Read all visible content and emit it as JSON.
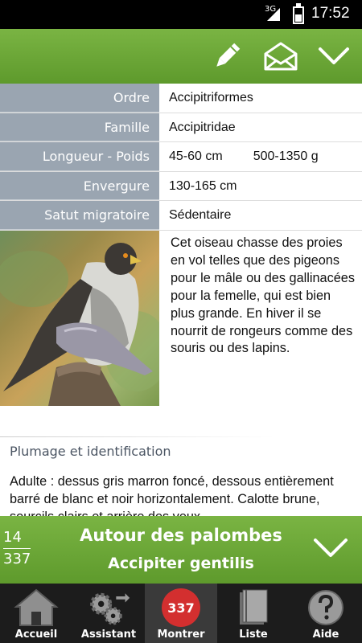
{
  "status_bar": {
    "network": "3G",
    "time": "17:52"
  },
  "toolbar": {
    "icons": [
      "pencil-icon",
      "envelope-icon",
      "chevron-down-icon"
    ]
  },
  "info_table": [
    {
      "label": "Ordre",
      "value": "Accipitriformes",
      "value2": ""
    },
    {
      "label": "Famille",
      "value": "Accipitridae",
      "value2": ""
    },
    {
      "label": "Longueur - Poids",
      "value": "45-60 cm",
      "value2": "500-1350 g"
    },
    {
      "label": "Envergure",
      "value": "130-165 cm",
      "value2": ""
    },
    {
      "label": "Satut migratoire",
      "value": "Sédentaire",
      "value2": ""
    }
  ],
  "description": "Cet oiseau chasse des proies en vol telles que des pigeons pour le mâle ou des gallinacées pour la femelle, qui est bien plus grande. En hiver il se nourrit de rongeurs comme des souris ou des lapins.",
  "plumage": {
    "title": "Plumage et identification",
    "text": "Adulte : dessus gris marron foncé, dessous entièrement barré de blanc et noir horizontalement. Calotte brune, sourcils clairs et arrière des yeux"
  },
  "species": {
    "index": "14",
    "total": "337",
    "common_name": "Autour des palombes",
    "latin_name": "Accipiter gentilis"
  },
  "bottom_nav": [
    {
      "label": "Accueil",
      "icon": "home-icon"
    },
    {
      "label": "Assistant",
      "icon": "gears-icon"
    },
    {
      "label": "Montrer",
      "icon": "count-badge",
      "badge": "337"
    },
    {
      "label": "Liste",
      "icon": "book-icon"
    },
    {
      "label": "Aide",
      "icon": "help-icon"
    }
  ],
  "colors": {
    "accent_green": "#6aa637",
    "label_bg": "#9aa5b1",
    "badge_red": "#d32f2f",
    "nav_bg": "#1c1c1c"
  }
}
